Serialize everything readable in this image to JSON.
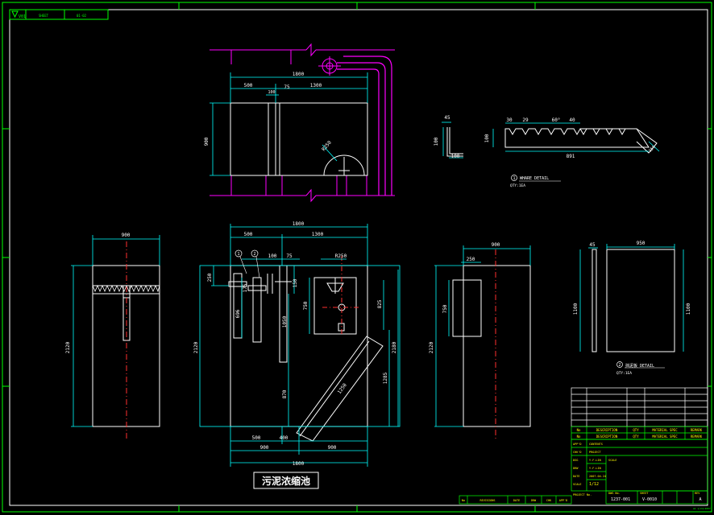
{
  "colors": {
    "white": "#ffffff",
    "cyan": "#00ffff",
    "magenta": "#ff00ff",
    "yellow": "#ffff00",
    "green": "#00ff00",
    "red": "#ff3030",
    "bg": "#000000"
  },
  "header": {
    "rev": "V01",
    "t2": "SHEET",
    "t3": "01-02"
  },
  "title": "污泥浓缩池",
  "top_view": {
    "d1800": "1800",
    "d500": "500",
    "d1300": "1300",
    "d100": "100",
    "d75": "75",
    "d900": "900",
    "r": "R250"
  },
  "wehr": {
    "d45": "45",
    "d100a": "100",
    "d100b": "100",
    "d100c": "100",
    "d30": "30",
    "d29": "29",
    "d60": "60°",
    "d40": "40",
    "d891": "891",
    "d150": "150",
    "num": "1",
    "label": "WHARE DETAIL",
    "qty": "QTY:1EA"
  },
  "front_left": {
    "d900": "900",
    "d2120": "2120"
  },
  "section": {
    "d1800": "1800",
    "d500": "500",
    "d1300": "1300",
    "d100": "100",
    "d75": "75",
    "d250": "250",
    "d150": "150",
    "d175": "175",
    "d696": "696",
    "d1050": "1050",
    "d870": "870",
    "d500b": "500",
    "d400": "400",
    "d900a": "900",
    "d900b": "900",
    "d1800b": "1800",
    "d2120": "2120",
    "d2180": "2180",
    "d1285": "1285",
    "d825": "825",
    "d750": "750",
    "r250": "R250",
    "d1250": "1250",
    "c1": "1",
    "c2": "2"
  },
  "right_view": {
    "d900": "900",
    "d250": "250",
    "d750": "750",
    "d2120": "2120"
  },
  "baffle": {
    "d45": "45",
    "d950": "950",
    "d1100a": "1100",
    "d1100b": "1100",
    "num": "2",
    "label": "挡泥板 DETAIL",
    "qty": "QTY:1EA"
  },
  "title_block": {
    "head": [
      "No",
      "DESCRIPTION",
      "QTY",
      "MATERIAL SPEC",
      "REMARK"
    ],
    "head2": [
      "No",
      "DESCRIPTION",
      "QTY",
      "MATERIAL SPEC",
      "REMARK"
    ],
    "rows": [
      {
        "k": "APP'D",
        "v": "CONTENTS"
      },
      {
        "k": "CHK'D",
        "v": "PROJECT"
      },
      {
        "k": "DSG",
        "v": "Y.F.LIN"
      },
      {
        "k": "DRW",
        "v": "Y.F.LIN"
      },
      {
        "k": "DATE",
        "v": "2007.04.24"
      },
      {
        "k": "SCALE",
        "v": "1/12"
      }
    ],
    "scale_label": "SCALE",
    "project_no": "PROJECT No.",
    "dwg_no_label": "DWG No.",
    "dwg_no": "1237-001",
    "sheet_label": "SHEET",
    "sheet": "V-0010",
    "rev_label": "REV",
    "rev": "A",
    "rev_cols": [
      "No",
      "REVISIONS",
      "DATE",
      "DRW",
      "CHK",
      "APP'D"
    ],
    "ref": "A1 1/24/2007"
  }
}
